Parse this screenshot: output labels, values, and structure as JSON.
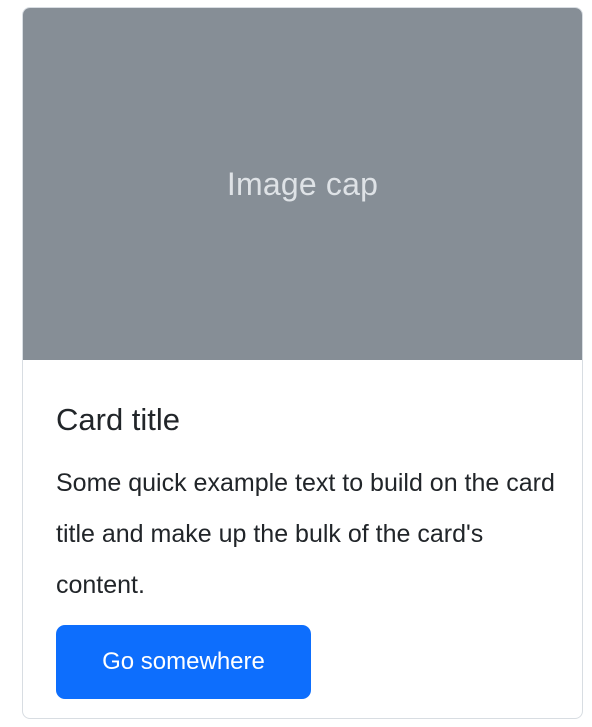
{
  "card": {
    "image_cap_text": "Image cap",
    "title": "Card title",
    "text": "Some quick example text to build on the card title and make up the bulk of the card's content.",
    "button_label": "Go somewhere"
  },
  "colors": {
    "image_cap_bg": "#868e96",
    "image_cap_text": "#dee2e6",
    "primary_button": "#0d6efd",
    "body_text": "#212529",
    "card_border": "#d8dde2"
  }
}
